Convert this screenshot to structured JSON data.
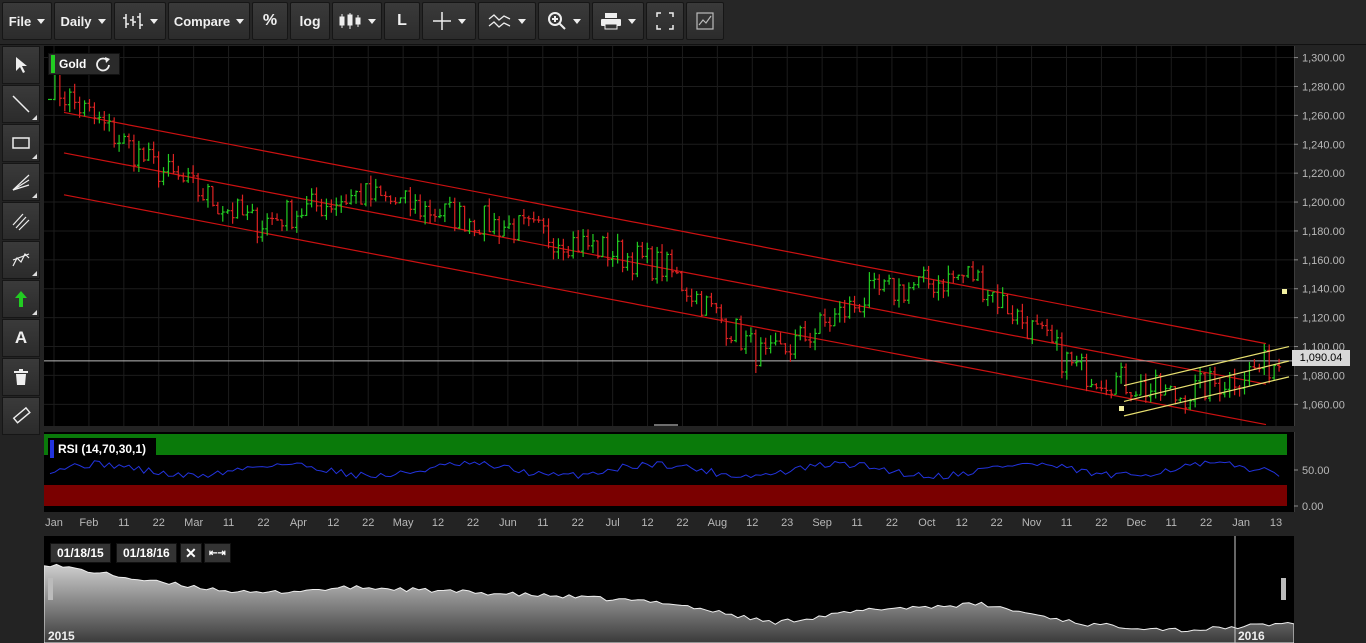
{
  "toolbar": {
    "file_label": "File",
    "period_label": "Daily",
    "compare_label": "Compare",
    "percent_label": "%",
    "log_label": "log",
    "l_label": "L"
  },
  "chart": {
    "symbol": "Gold",
    "price_label": "1,090.04",
    "rsi_legend": "RSI (14,70,30,1)",
    "y_ticks": [
      "1,300.00",
      "1,280.00",
      "1,260.00",
      "1,240.00",
      "1,220.00",
      "1,200.00",
      "1,180.00",
      "1,160.00",
      "1,140.00",
      "1,120.00",
      "1,100.00",
      "1,080.00",
      "1,060.00"
    ],
    "rsi_ticks": [
      "50.00",
      "0.00"
    ],
    "x_ticks": [
      "Jan",
      "Feb",
      "11",
      "22",
      "Mar",
      "11",
      "22",
      "Apr",
      "12",
      "22",
      "May",
      "12",
      "22",
      "Jun",
      "11",
      "22",
      "Jul",
      "12",
      "22",
      "Aug",
      "12",
      "23",
      "Sep",
      "11",
      "22",
      "Oct",
      "12",
      "22",
      "Nov",
      "11",
      "22",
      "Dec",
      "11",
      "22",
      "Jan",
      "13"
    ],
    "colors": {
      "up": "#22cc22",
      "down": "#dd2222",
      "channel": "#cc1111",
      "rsi_line": "#2233dd",
      "overbought": "#0a7a0a",
      "oversold": "#7a0000"
    }
  },
  "navigator": {
    "start_date": "01/18/15",
    "end_date": "01/18/16",
    "year_left": "2015",
    "year_right": "2016"
  },
  "chart_data": {
    "type": "candlestick",
    "title": "Gold",
    "ylim": [
      1045,
      1308
    ],
    "x": [
      "Jan",
      "Feb",
      "Mar",
      "Apr",
      "May",
      "Jun",
      "Jul",
      "Aug",
      "Sep",
      "Oct",
      "Nov",
      "Dec",
      "Jan"
    ],
    "close": [
      1282,
      1225,
      1185,
      1205,
      1190,
      1175,
      1155,
      1090,
      1135,
      1150,
      1085,
      1065,
      1090.04
    ],
    "last": 1090.04,
    "rsi": {
      "period": 14,
      "overbought": 70,
      "oversold": 30,
      "ylim": [
        0,
        100
      ]
    }
  }
}
